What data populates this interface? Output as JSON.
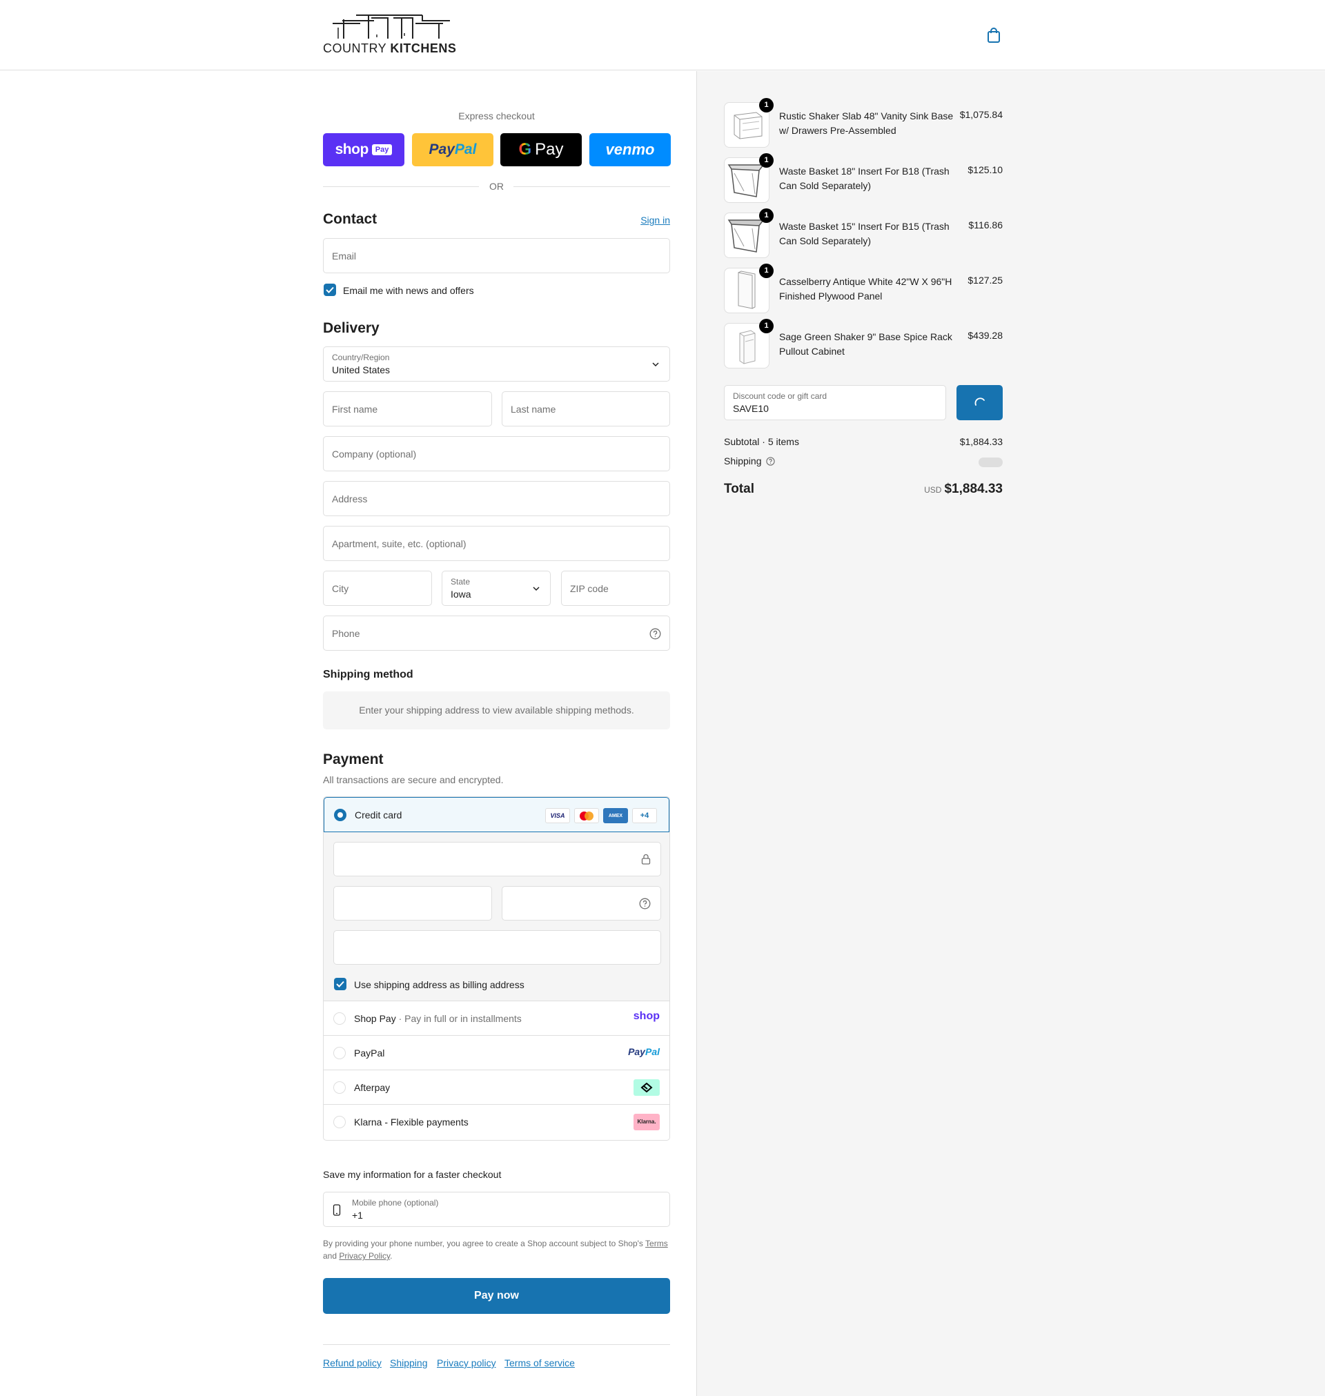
{
  "header": {
    "brand_light": "COUNTRY",
    "brand_bold": "KITCHENS"
  },
  "express": {
    "title": "Express checkout",
    "shop_pay": "shop",
    "shop_pay_pill": "Pay",
    "paypal_a": "Pay",
    "paypal_b": "Pal",
    "gpay": "Pay",
    "venmo": "venmo",
    "or": "OR"
  },
  "contact": {
    "heading": "Contact",
    "sign_in": "Sign in",
    "email_placeholder": "Email",
    "news_label": "Email me with news and offers"
  },
  "delivery": {
    "heading": "Delivery",
    "country_label": "Country/Region",
    "country_value": "United States",
    "first_name": "First name",
    "last_name": "Last name",
    "company": "Company (optional)",
    "address": "Address",
    "apartment": "Apartment, suite, etc. (optional)",
    "city": "City",
    "state_label": "State",
    "state_value": "Iowa",
    "zip": "ZIP code",
    "phone": "Phone"
  },
  "shipping_method": {
    "heading": "Shipping method",
    "message": "Enter your shipping address to view available shipping methods."
  },
  "payment": {
    "heading": "Payment",
    "subtitle": "All transactions are secure and encrypted.",
    "credit_card": "Credit card",
    "card_logos": [
      "VISA",
      "",
      "AMEX",
      "+4"
    ],
    "billing_label": "Use shipping address as billing address",
    "shop_pay": "Shop Pay",
    "shop_pay_sub": "Pay in full or in installments",
    "shop_logo": "shop",
    "paypal": "PayPal",
    "paypal_logo_a": "Pay",
    "paypal_logo_b": "Pal",
    "afterpay": "Afterpay",
    "klarna": "Klarna - Flexible payments",
    "klarna_logo": "Klarna."
  },
  "save_info": {
    "heading": "Save my information for a faster checkout",
    "mobile_label": "Mobile phone (optional)",
    "mobile_value": "+1",
    "legal_prefix": "By providing your phone number, you agree to create a Shop account subject to Shop's",
    "terms": "Terms",
    "and": "and",
    "privacy": "Privacy Policy",
    "period": "."
  },
  "pay_now": "Pay now",
  "footer": {
    "refund": "Refund policy",
    "shipping": "Shipping",
    "privacy": "Privacy policy",
    "terms": "Terms of service"
  },
  "summary": {
    "items": [
      {
        "name": "Rustic Shaker Slab 48\" Vanity Sink Base w/ Drawers Pre-Assembled",
        "price": "$1,075.84",
        "qty": "1"
      },
      {
        "name": "Waste Basket 18\" Insert For B18 (Trash Can Sold Separately)",
        "price": "$125.10",
        "qty": "1"
      },
      {
        "name": "Waste Basket 15\" Insert For B15 (Trash Can Sold Separately)",
        "price": "$116.86",
        "qty": "1"
      },
      {
        "name": "Casselberry Antique White 42\"W X 96\"H Finished Plywood Panel",
        "price": "$127.25",
        "qty": "1"
      },
      {
        "name": "Sage Green Shaker 9\" Base Spice Rack Pullout Cabinet",
        "price": "$439.28",
        "qty": "1"
      }
    ],
    "discount_label": "Discount code or gift card",
    "discount_value": "SAVE10",
    "subtotal_label": "Subtotal · 5 items",
    "subtotal_value": "$1,884.33",
    "shipping_label": "Shipping",
    "total_label": "Total",
    "currency": "USD",
    "total_value": "$1,884.33"
  },
  "colors": {
    "accent": "#1773b0",
    "shop_purple": "#5a31f4",
    "paypal_yellow": "#ffc439",
    "venmo_blue": "#008cff"
  }
}
